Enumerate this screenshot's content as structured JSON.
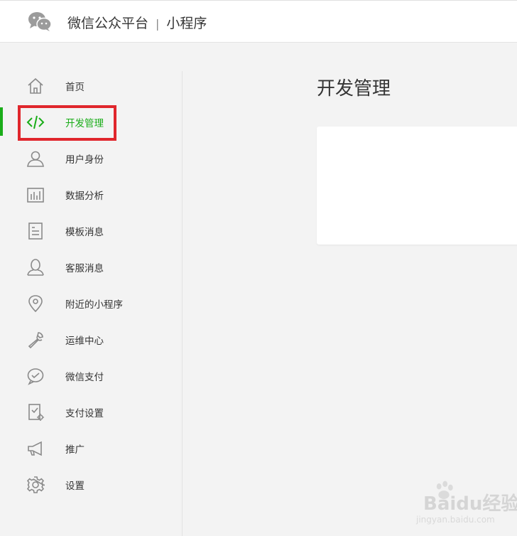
{
  "header": {
    "brand": "微信公众平台",
    "separator": "|",
    "product": "小程序",
    "logo_icon": "wechat-logo-icon"
  },
  "sidebar": {
    "active_color": "#1aad19",
    "items": [
      {
        "label": "首页",
        "icon": "home-icon"
      },
      {
        "label": "开发管理",
        "icon": "code-icon",
        "active": true
      },
      {
        "label": "用户身份",
        "icon": "user-icon"
      },
      {
        "label": "数据分析",
        "icon": "bar-chart-icon"
      },
      {
        "label": "模板消息",
        "icon": "document-icon"
      },
      {
        "label": "客服消息",
        "icon": "support-agent-icon"
      },
      {
        "label": "附近的小程序",
        "icon": "location-pin-icon"
      },
      {
        "label": "运维中心",
        "icon": "wrench-icon"
      },
      {
        "label": "微信支付",
        "icon": "wechat-pay-icon"
      },
      {
        "label": "支付设置",
        "icon": "payment-settings-icon"
      },
      {
        "label": "推广",
        "icon": "megaphone-icon"
      },
      {
        "label": "设置",
        "icon": "gear-icon"
      }
    ]
  },
  "main": {
    "title": "开发管理"
  },
  "highlight_color": "#e0262c",
  "watermark": {
    "text": "Baidu经验",
    "sub": "jingyan.baidu.com"
  }
}
